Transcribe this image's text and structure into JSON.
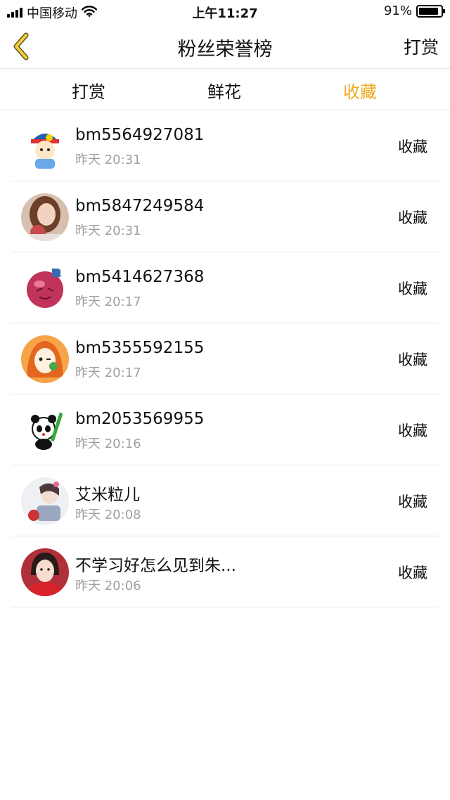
{
  "status_bar": {
    "carrier": "中国移动",
    "time": "上午11:27",
    "battery_percent": "91%",
    "battery_level": 0.91,
    "icons": [
      "signal-icon",
      "wifi-icon",
      "battery-icon"
    ]
  },
  "nav": {
    "back_icon": "chevron-left-icon",
    "title": "粉丝荣誉榜",
    "action_label": "打赏"
  },
  "tabs": [
    {
      "label": "打赏",
      "active": false
    },
    {
      "label": "鲜花",
      "active": false
    },
    {
      "label": "收藏",
      "active": true
    }
  ],
  "accent_color": "#f0a81e",
  "list": [
    {
      "name": "bm5564927081",
      "time": "昨天 20:31",
      "action": "收藏"
    },
    {
      "name": "bm5847249584",
      "time": "昨天 20:31",
      "action": "收藏"
    },
    {
      "name": "bm5414627368",
      "time": "昨天 20:17",
      "action": "收藏"
    },
    {
      "name": "bm5355592155",
      "time": "昨天 20:17",
      "action": "收藏"
    },
    {
      "name": "bm2053569955",
      "time": "昨天 20:16",
      "action": "收藏"
    },
    {
      "name": "艾米粒儿",
      "time": "昨天 20:08",
      "action": "收藏"
    },
    {
      "name": "不学习好怎么见到朱...",
      "time": "昨天 20:06",
      "action": "收藏"
    }
  ]
}
